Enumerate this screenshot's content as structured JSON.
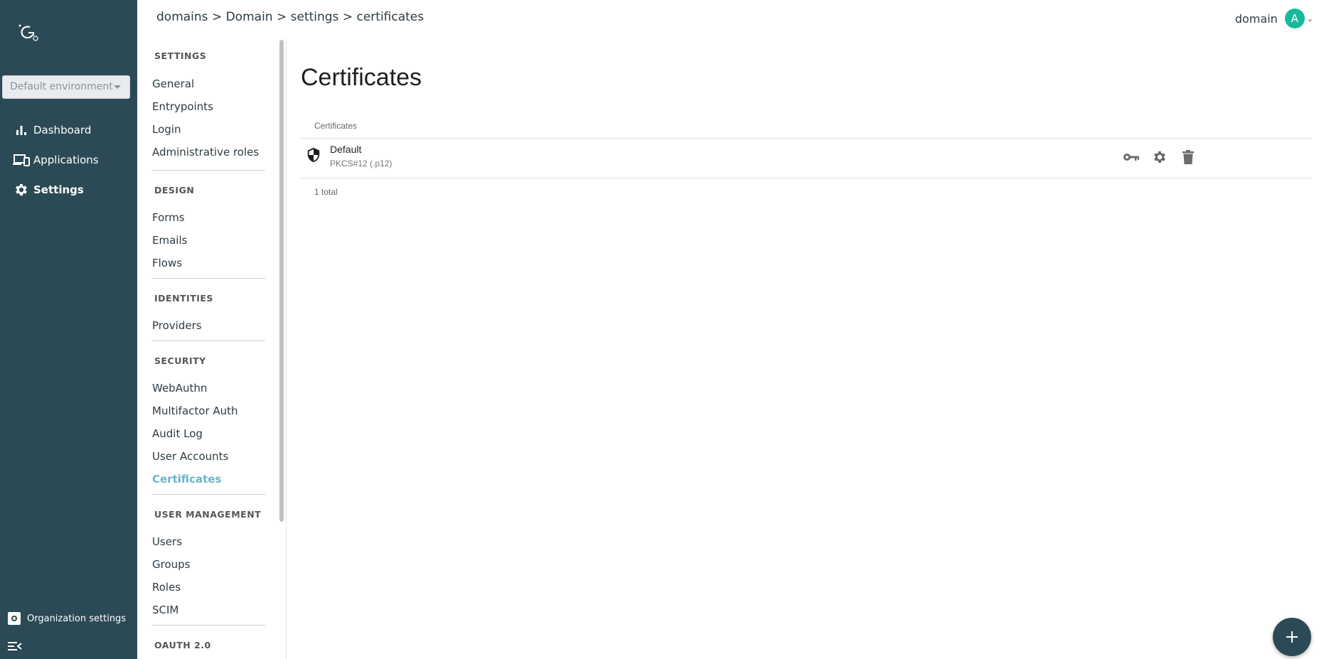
{
  "sidebar": {
    "environment": "Default environment",
    "items": [
      {
        "label": "Dashboard"
      },
      {
        "label": "Applications"
      },
      {
        "label": "Settings"
      }
    ],
    "org_settings": "Organization settings"
  },
  "breadcrumb": [
    "domains",
    ">",
    "Domain",
    ">",
    "settings",
    ">",
    "certificates"
  ],
  "user": {
    "name": "domain",
    "initial": "A"
  },
  "subnav": {
    "settings": {
      "title": "SETTINGS",
      "items": [
        "General",
        "Entrypoints",
        "Login",
        "Administrative roles"
      ]
    },
    "design": {
      "title": "DESIGN",
      "items": [
        "Forms",
        "Emails",
        "Flows"
      ]
    },
    "identities": {
      "title": "IDENTITIES",
      "items": [
        "Providers"
      ]
    },
    "security": {
      "title": "SECURITY",
      "items": [
        "WebAuthn",
        "Multifactor Auth",
        "Audit Log",
        "User Accounts",
        "Certificates"
      ]
    },
    "user_management": {
      "title": "USER MANAGEMENT",
      "items": [
        "Users",
        "Groups",
        "Roles",
        "SCIM"
      ]
    },
    "oauth": {
      "title": "OAUTH 2.0"
    }
  },
  "main": {
    "title": "Certificates",
    "table_header": "Certificates",
    "rows": [
      {
        "name": "Default",
        "type": "PKCS#12 (.p12)"
      }
    ],
    "total": "1 total"
  },
  "colors": {
    "sidebar": "#2b4a55",
    "active_link": "#6db4c9",
    "avatar": "#19b89a"
  }
}
